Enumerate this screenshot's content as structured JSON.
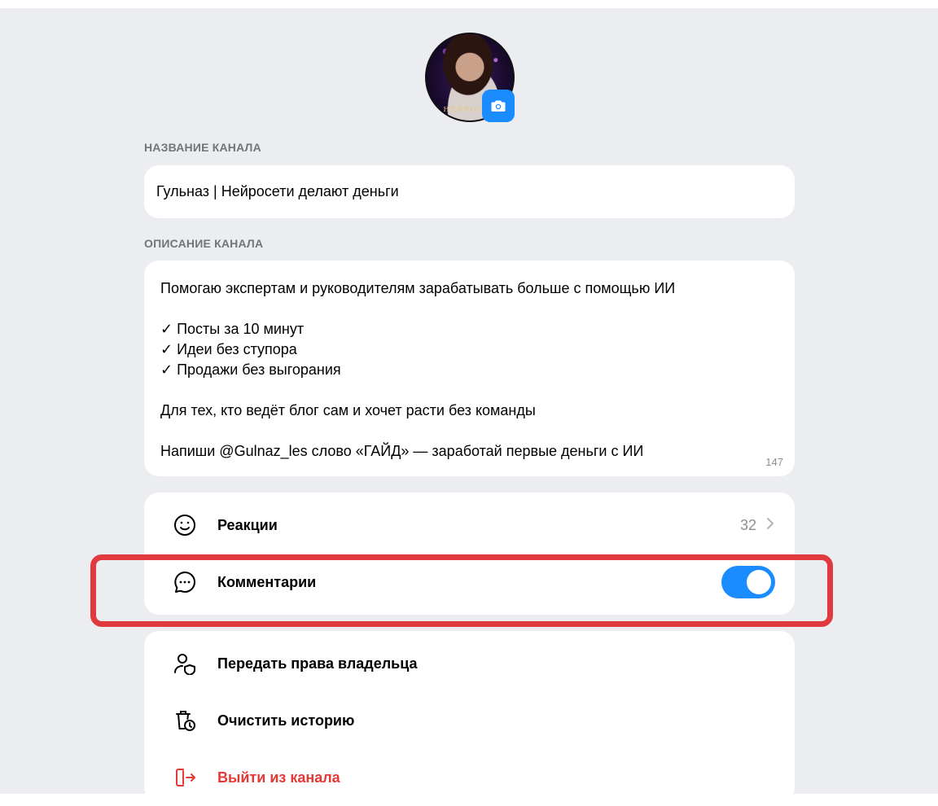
{
  "avatar": {
    "caption": "НЕЙРОСЕТ",
    "camera_icon": "camera-icon"
  },
  "channel_name": {
    "label": "НАЗВАНИЕ КАНАЛА",
    "value": "Гульназ | Нейросети делают деньги"
  },
  "channel_description": {
    "label": "ОПИСАНИЕ КАНАЛА",
    "lines": [
      "Помогаю экспертам и руководителям зарабатывать больше с помощью ИИ",
      "",
      "✓ Посты за 10 минут",
      "✓ Идеи без ступора",
      "✓ Продажи без выгорания",
      "",
      "Для тех, кто ведёт блог сам и хочет расти без команды",
      "",
      "Напиши @Gulnaz_les слово «ГАЙД» — заработай первые деньги с ИИ"
    ],
    "counter": "147"
  },
  "settings": {
    "reactions": {
      "label": "Реакции",
      "value": "32",
      "icon": "smile-icon"
    },
    "comments": {
      "label": "Комментарии",
      "enabled": true,
      "icon": "chat-bubble-icon"
    }
  },
  "actions": {
    "transfer_owner": {
      "label": "Передать права владельца",
      "icon": "user-shield-icon"
    },
    "clear_history": {
      "label": "Очистить историю",
      "icon": "trash-clock-icon"
    },
    "leave_channel": {
      "label": "Выйти из канала",
      "icon": "exit-icon"
    }
  },
  "colors": {
    "accent": "#1a8cff",
    "danger": "#e53935",
    "highlight": "#e0393e",
    "background": "#ebedf0"
  }
}
